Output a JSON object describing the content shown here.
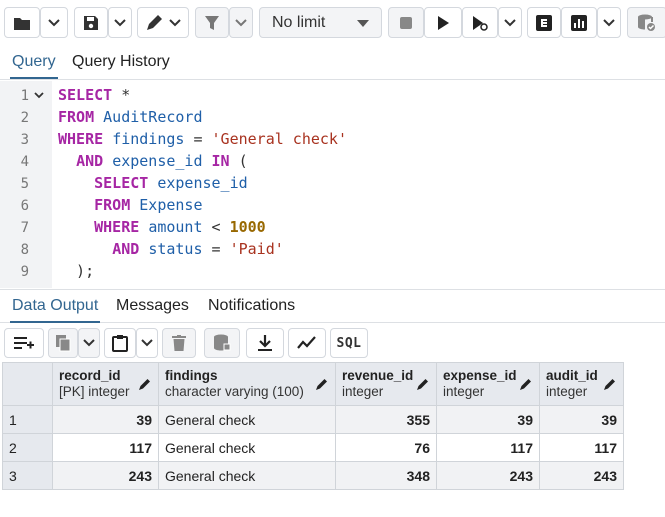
{
  "toolbar": {
    "limit_label": "No limit"
  },
  "query_tabs": [
    {
      "label": "Query"
    },
    {
      "label": "Query History"
    }
  ],
  "editor": {
    "line_numbers": [
      "1",
      "2",
      "3",
      "4",
      "5",
      "6",
      "7",
      "8",
      "9"
    ],
    "lines": [
      [
        {
          "t": "kw",
          "v": "SELECT"
        },
        {
          "t": "op",
          "v": " *"
        }
      ],
      [
        {
          "t": "kw",
          "v": "FROM"
        },
        {
          "t": "op",
          "v": " "
        },
        {
          "t": "id",
          "v": "AuditRecord"
        }
      ],
      [
        {
          "t": "kw",
          "v": "WHERE"
        },
        {
          "t": "op",
          "v": " "
        },
        {
          "t": "id",
          "v": "findings"
        },
        {
          "t": "op",
          "v": " = "
        },
        {
          "t": "str",
          "v": "'General check'"
        }
      ],
      [
        {
          "t": "op",
          "v": "  "
        },
        {
          "t": "kw",
          "v": "AND"
        },
        {
          "t": "op",
          "v": " "
        },
        {
          "t": "id",
          "v": "expense_id"
        },
        {
          "t": "op",
          "v": " "
        },
        {
          "t": "kw",
          "v": "IN"
        },
        {
          "t": "op",
          "v": " ("
        }
      ],
      [
        {
          "t": "op",
          "v": "    "
        },
        {
          "t": "kw",
          "v": "SELECT"
        },
        {
          "t": "op",
          "v": " "
        },
        {
          "t": "id",
          "v": "expense_id"
        }
      ],
      [
        {
          "t": "op",
          "v": "    "
        },
        {
          "t": "kw",
          "v": "FROM"
        },
        {
          "t": "op",
          "v": " "
        },
        {
          "t": "id",
          "v": "Expense"
        }
      ],
      [
        {
          "t": "op",
          "v": "    "
        },
        {
          "t": "kw",
          "v": "WHERE"
        },
        {
          "t": "op",
          "v": " "
        },
        {
          "t": "id",
          "v": "amount"
        },
        {
          "t": "op",
          "v": " < "
        },
        {
          "t": "num",
          "v": "1000"
        }
      ],
      [
        {
          "t": "op",
          "v": "      "
        },
        {
          "t": "kw",
          "v": "AND"
        },
        {
          "t": "op",
          "v": " "
        },
        {
          "t": "id",
          "v": "status"
        },
        {
          "t": "op",
          "v": " = "
        },
        {
          "t": "str",
          "v": "'Paid'"
        }
      ],
      [
        {
          "t": "op",
          "v": "  );"
        }
      ]
    ]
  },
  "result_tabs": [
    {
      "label": "Data Output"
    },
    {
      "label": "Messages"
    },
    {
      "label": "Notifications"
    }
  ],
  "result_toolbar": {
    "sql_label": "SQL"
  },
  "grid": {
    "columns": [
      {
        "name": "record_id",
        "type": "[PK] integer"
      },
      {
        "name": "findings",
        "type": "character varying (100)"
      },
      {
        "name": "revenue_id",
        "type": "integer"
      },
      {
        "name": "expense_id",
        "type": "integer"
      },
      {
        "name": "audit_id",
        "type": "integer"
      }
    ],
    "rows": [
      {
        "n": "1",
        "cells": [
          "39",
          "General check",
          "355",
          "39",
          "39"
        ]
      },
      {
        "n": "2",
        "cells": [
          "117",
          "General check",
          "76",
          "117",
          "117"
        ]
      },
      {
        "n": "3",
        "cells": [
          "243",
          "General check",
          "348",
          "243",
          "243"
        ]
      }
    ]
  },
  "colors": {
    "accent": "#326690",
    "keyword": "#a626a4",
    "identifier": "#1f5fa8",
    "string": "#a8321f",
    "number": "#986801"
  }
}
